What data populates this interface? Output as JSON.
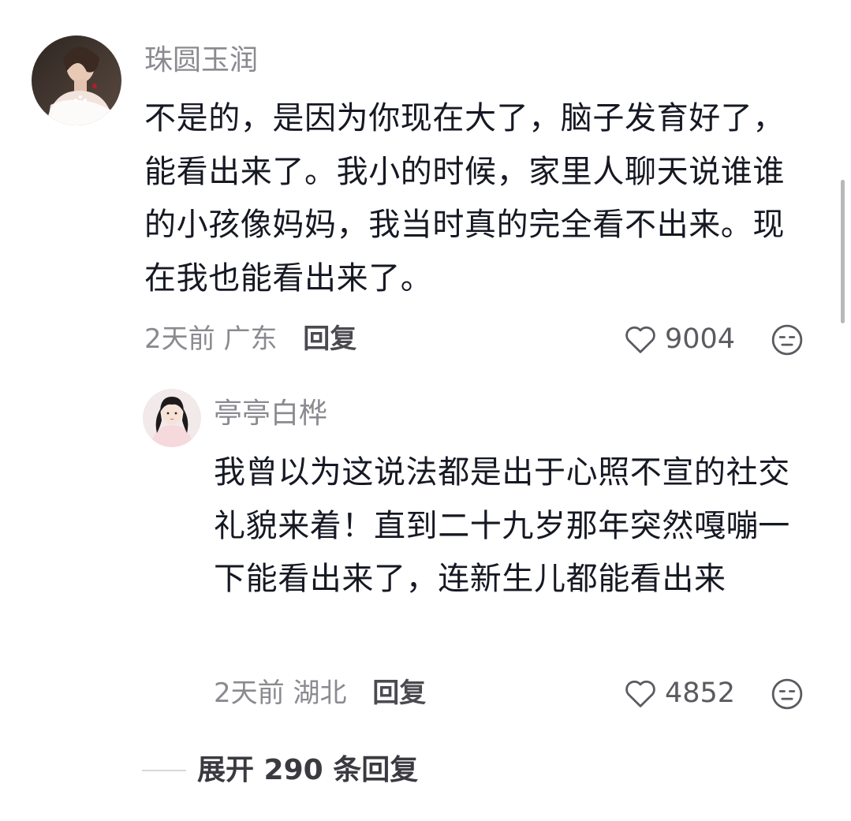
{
  "comments": [
    {
      "username": "珠圆玉润",
      "content": "不是的，是因为你现在大了，脑子发育好了，能看出来了。我小的时候，家里人聊天说谁谁的小孩像妈妈，我当时真的完全看不出来。现在我也能看出来了。",
      "time": "2天前",
      "location": "广东",
      "reply_label": "回复",
      "likes": "9004",
      "icons": {
        "like": "heart-outline-icon",
        "dislike": "neutral-face-icon"
      }
    },
    {
      "username": "亭亭白桦",
      "content": "我曾以为这说法都是出于心照不宣的社交礼貌来着！直到二十九岁那年突然嘎嘣一下能看出来了，连新生儿都能看出来",
      "time": "2天前",
      "location": "湖北",
      "reply_label": "回复",
      "likes": "4852",
      "icons": {
        "like": "heart-outline-icon",
        "dislike": "neutral-face-icon"
      }
    }
  ],
  "expand_replies": {
    "label": "展开 290 条回复"
  },
  "colors": {
    "text_primary": "#161823",
    "text_secondary": "#8a8a90",
    "reply_action": "#4a4a50",
    "background": "#ffffff"
  }
}
